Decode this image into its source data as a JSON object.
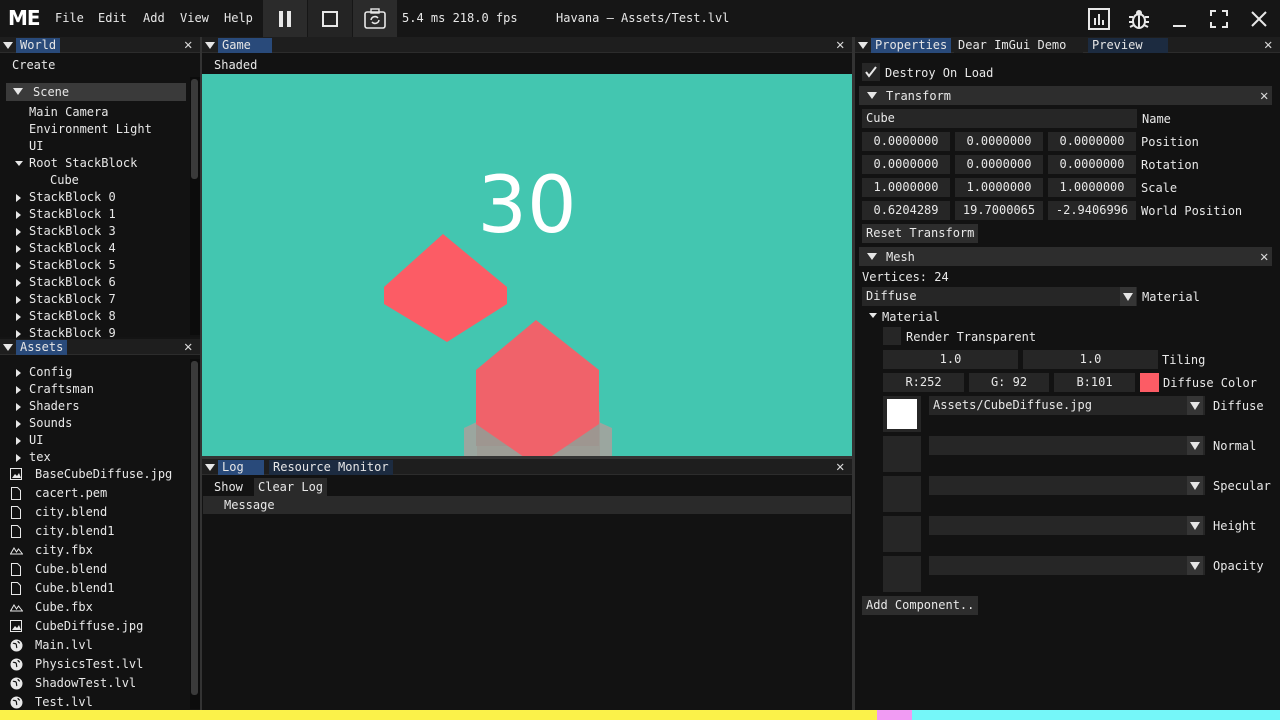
{
  "app": {
    "logo": "ME",
    "menu": [
      "File",
      "Edit",
      "Add",
      "View",
      "Help"
    ],
    "stats": "5.4 ms 218.0 fps",
    "window_title": "Havana – Assets/Test.lvl",
    "toolbar_icons": [
      "pause-icon",
      "stop-icon",
      "reload-icon"
    ],
    "window_icons": [
      "chart-icon",
      "bug-icon",
      "minimize-icon",
      "maximize-icon",
      "close-icon"
    ]
  },
  "world": {
    "tab": "World",
    "create_label": "Create",
    "scene_label": "Scene",
    "items": [
      {
        "label": "Main Camera",
        "level": 1,
        "arrow": false
      },
      {
        "label": "Environment Light",
        "level": 1,
        "arrow": false
      },
      {
        "label": "UI",
        "level": 1,
        "arrow": false
      },
      {
        "label": "Root StackBlock",
        "level": 1,
        "arrow": "open"
      },
      {
        "label": "Cube",
        "level": 2,
        "arrow": false
      },
      {
        "label": "StackBlock 0",
        "level": 1,
        "arrow": "closed"
      },
      {
        "label": "StackBlock 1",
        "level": 1,
        "arrow": "closed"
      },
      {
        "label": "StackBlock 3",
        "level": 1,
        "arrow": "closed"
      },
      {
        "label": "StackBlock 4",
        "level": 1,
        "arrow": "closed"
      },
      {
        "label": "StackBlock 5",
        "level": 1,
        "arrow": "closed"
      },
      {
        "label": "StackBlock 6",
        "level": 1,
        "arrow": "closed"
      },
      {
        "label": "StackBlock 7",
        "level": 1,
        "arrow": "closed"
      },
      {
        "label": "StackBlock 8",
        "level": 1,
        "arrow": "closed"
      },
      {
        "label": "StackBlock 9",
        "level": 1,
        "arrow": "closed"
      }
    ]
  },
  "assets": {
    "tab": "Assets",
    "folders": [
      "Config",
      "Craftsman",
      "Shaders",
      "Sounds",
      "UI",
      "tex"
    ],
    "files": [
      {
        "label": "BaseCubeDiffuse.jpg",
        "icon": "image-icon"
      },
      {
        "label": "cacert.pem",
        "icon": "file-icon"
      },
      {
        "label": "city.blend",
        "icon": "file-icon"
      },
      {
        "label": "city.blend1",
        "icon": "file-icon"
      },
      {
        "label": "city.fbx",
        "icon": "mesh-icon"
      },
      {
        "label": "Cube.blend",
        "icon": "file-icon"
      },
      {
        "label": "Cube.blend1",
        "icon": "file-icon"
      },
      {
        "label": "Cube.fbx",
        "icon": "mesh-icon"
      },
      {
        "label": "CubeDiffuse.jpg",
        "icon": "image-icon"
      },
      {
        "label": "Main.lvl",
        "icon": "globe-icon"
      },
      {
        "label": "PhysicsTest.lvl",
        "icon": "globe-icon"
      },
      {
        "label": "ShadowTest.lvl",
        "icon": "globe-icon"
      },
      {
        "label": "Test.lvl",
        "icon": "globe-icon"
      }
    ]
  },
  "game": {
    "tab": "Game",
    "mode": "Shaded",
    "score": "30",
    "bg_color": "#43c6b0",
    "cube_color": "#fc5c65"
  },
  "log": {
    "tabs": [
      "Log",
      "Resource Monitor"
    ],
    "show_label": "Show",
    "clear_label": "Clear Log",
    "column": "Message"
  },
  "properties": {
    "tabs": [
      "Properties",
      "Dear ImGui Demo",
      "Preview"
    ],
    "destroy_on_load": "Destroy On Load",
    "transform": {
      "title": "Transform",
      "name_value": "Cube",
      "name_label": "Name",
      "rows": [
        {
          "values": [
            "0.0000000",
            "0.0000000",
            "0.0000000"
          ],
          "label": "Position"
        },
        {
          "values": [
            "0.0000000",
            "0.0000000",
            "0.0000000"
          ],
          "label": "Rotation"
        },
        {
          "values": [
            "1.0000000",
            "1.0000000",
            "1.0000000"
          ],
          "label": "Scale"
        },
        {
          "values": [
            "0.6204289",
            "19.7000065",
            "-2.9406996"
          ],
          "label": "World Position"
        }
      ],
      "reset_label": "Reset Transform"
    },
    "mesh": {
      "title": "Mesh",
      "vertices": "Vertices: 24",
      "material_value": "Diffuse",
      "material_label": "Material",
      "material_section": "Material",
      "render_transparent": "Render Transparent",
      "tiling": [
        "1.0",
        "1.0"
      ],
      "tiling_label": "Tiling",
      "color": [
        "R:252",
        "G: 92",
        "B:101"
      ],
      "color_label": "Diffuse Color",
      "swatch": "#fc5c65",
      "textures": [
        {
          "value": "Assets/CubeDiffuse.jpg",
          "label": "Diffuse"
        },
        {
          "value": "",
          "label": "Normal"
        },
        {
          "value": "",
          "label": "Specular"
        },
        {
          "value": "",
          "label": "Height"
        },
        {
          "value": "",
          "label": "Opacity"
        }
      ]
    },
    "add_component": "Add Component.."
  },
  "bottom_bar_colors": [
    "#fbf24a",
    "#f19bf3",
    "#75f7f9"
  ]
}
